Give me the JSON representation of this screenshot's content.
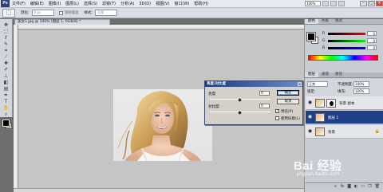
{
  "app": {
    "menu": [
      "文件(F)",
      "编辑(E)",
      "图像(I)",
      "图层(L)",
      "选择(S)",
      "滤镜(T)",
      "分析(A)",
      "3D(D)",
      "视图(V)",
      "窗口(W)",
      "帮助(H)"
    ],
    "zoom": "100%"
  },
  "options": {
    "feather_label": "羽化:",
    "feather_value": "0 px",
    "style_label": "样式:",
    "style_value": "正常",
    "anti_alias_label": "消除锯齿"
  },
  "document": {
    "tab_title": "美女1.jpg @ 100% (图层 1, RGB/8) *"
  },
  "dialog": {
    "title": "亮度/对比度",
    "brightness_label": "亮度:",
    "brightness_value": "0",
    "contrast_label": "对比度:",
    "contrast_value": "0",
    "ok_label": "确定",
    "cancel_label": "取消",
    "preview_label": "预览(P)",
    "preview_checked": true,
    "legacy_label": "使用旧版(L)",
    "legacy_checked": false
  },
  "color_panel": {
    "tabs": [
      "颜色",
      "色板",
      "样式"
    ],
    "channels": [
      {
        "label": "R",
        "value": "0",
        "color": "#d42020"
      },
      {
        "label": "G",
        "value": "0",
        "color": "#20a040"
      },
      {
        "label": "B",
        "value": "0",
        "color": "#2040d0"
      }
    ]
  },
  "layers_panel": {
    "tabs": [
      "图层",
      "通道",
      "路径"
    ],
    "blend_mode": "正常",
    "opacity_label": "不透明度:",
    "opacity_value": "100%",
    "lock_label": "锁定:",
    "fill_label": "填充:",
    "fill_value": "100%",
    "layers": [
      {
        "name": "背景 副本",
        "selected": false,
        "has_mask": true,
        "locked": false
      },
      {
        "name": "图层 1",
        "selected": true,
        "has_mask": false,
        "locked": false
      },
      {
        "name": "背景",
        "selected": false,
        "has_mask": false,
        "locked": true
      }
    ]
  },
  "watermark": {
    "brand": "Bai 经验",
    "url": "jingyan.baidu.com"
  }
}
